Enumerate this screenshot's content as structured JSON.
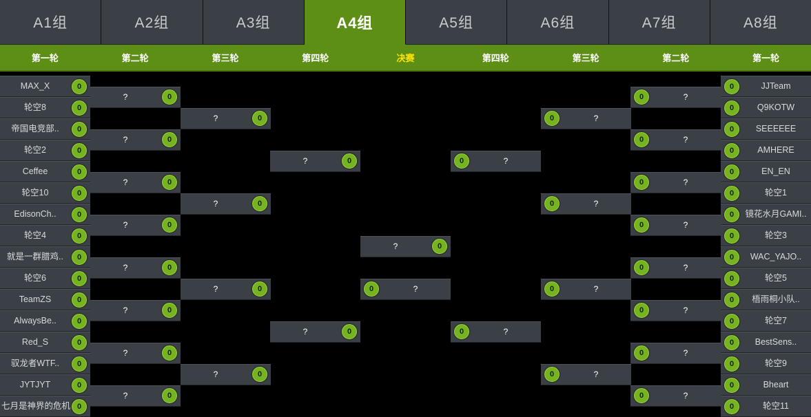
{
  "groups": {
    "active_index": 3,
    "tabs": [
      {
        "label": "A1组"
      },
      {
        "label": "A2组"
      },
      {
        "label": "A3组"
      },
      {
        "label": "A4组"
      },
      {
        "label": "A5组"
      },
      {
        "label": "A6组"
      },
      {
        "label": "A7组"
      },
      {
        "label": "A8组"
      }
    ]
  },
  "rounds": [
    {
      "label": "第一轮",
      "final": false
    },
    {
      "label": "第二轮",
      "final": false
    },
    {
      "label": "第三轮",
      "final": false
    },
    {
      "label": "第四轮",
      "final": false
    },
    {
      "label": "决赛",
      "final": true
    },
    {
      "label": "第四轮",
      "final": false
    },
    {
      "label": "第三轮",
      "final": false
    },
    {
      "label": "第二轮",
      "final": false
    },
    {
      "label": "第一轮",
      "final": false
    }
  ],
  "colors": {
    "brand_green": "#5d8f16",
    "score_badge": "#76b322",
    "final_label": "#ffe400",
    "cell_bg": "#3b4046",
    "canvas_bg": "#000000"
  },
  "placeholder_name": "?",
  "default_score": "0",
  "bracket": {
    "left": {
      "round1": [
        {
          "name": "MAX_X",
          "score": "0"
        },
        {
          "name": "轮空8",
          "score": "0"
        },
        {
          "name": "帝国电竞部..",
          "score": "0"
        },
        {
          "name": "轮空2",
          "score": "0"
        },
        {
          "name": "Ceffee",
          "score": "0"
        },
        {
          "name": "轮空10",
          "score": "0"
        },
        {
          "name": "EdisonCh..",
          "score": "0"
        },
        {
          "name": "轮空4",
          "score": "0"
        },
        {
          "name": "就是一群腊鸡..",
          "score": "0"
        },
        {
          "name": "轮空6",
          "score": "0"
        },
        {
          "name": "TeamZS",
          "score": "0"
        },
        {
          "name": "AlwaysBe..",
          "score": "0"
        },
        {
          "name": "Red_S",
          "score": "0"
        },
        {
          "name": "驭龙者WTF..",
          "score": "0"
        },
        {
          "name": "JYTJYT",
          "score": "0"
        },
        {
          "name": "七月是神界的危机",
          "score": "0"
        }
      ],
      "round2": [
        {
          "name": "?",
          "score": "0"
        },
        {
          "name": "?",
          "score": "0"
        },
        {
          "name": "?",
          "score": "0"
        },
        {
          "name": "?",
          "score": "0"
        },
        {
          "name": "?",
          "score": "0"
        },
        {
          "name": "?",
          "score": "0"
        },
        {
          "name": "?",
          "score": "0"
        },
        {
          "name": "?",
          "score": "0"
        }
      ],
      "round3": [
        {
          "name": "?",
          "score": "0"
        },
        {
          "name": "?",
          "score": "0"
        },
        {
          "name": "?",
          "score": "0"
        },
        {
          "name": "?",
          "score": "0"
        }
      ],
      "round4": [
        {
          "name": "?",
          "score": "0"
        },
        {
          "name": "?",
          "score": "0"
        }
      ],
      "final": [
        {
          "name": "?",
          "score": "0"
        }
      ]
    },
    "right": {
      "round1": [
        {
          "name": "JJTeam",
          "score": "0"
        },
        {
          "name": "Q9KOTW",
          "score": "0"
        },
        {
          "name": "SEEEEEE",
          "score": "0"
        },
        {
          "name": "AMHERE",
          "score": "0"
        },
        {
          "name": "EN_EN",
          "score": "0"
        },
        {
          "name": "轮空1",
          "score": "0"
        },
        {
          "name": "镜花水月GAMI..",
          "score": "0"
        },
        {
          "name": "轮空3",
          "score": "0"
        },
        {
          "name": "WAC_YAJO..",
          "score": "0"
        },
        {
          "name": "轮空5",
          "score": "0"
        },
        {
          "name": "梧雨桐小队..",
          "score": "0"
        },
        {
          "name": "轮空7",
          "score": "0"
        },
        {
          "name": "BestSens..",
          "score": "0"
        },
        {
          "name": "轮空9",
          "score": "0"
        },
        {
          "name": "Bheart",
          "score": "0"
        },
        {
          "name": "轮空11",
          "score": "0"
        }
      ],
      "round2": [
        {
          "name": "?",
          "score": "0"
        },
        {
          "name": "?",
          "score": "0"
        },
        {
          "name": "?",
          "score": "0"
        },
        {
          "name": "?",
          "score": "0"
        },
        {
          "name": "?",
          "score": "0"
        },
        {
          "name": "?",
          "score": "0"
        },
        {
          "name": "?",
          "score": "0"
        },
        {
          "name": "?",
          "score": "0"
        }
      ],
      "round3": [
        {
          "name": "?",
          "score": "0"
        },
        {
          "name": "?",
          "score": "0"
        },
        {
          "name": "?",
          "score": "0"
        },
        {
          "name": "?",
          "score": "0"
        }
      ],
      "round4": [
        {
          "name": "?",
          "score": "0"
        },
        {
          "name": "?",
          "score": "0"
        }
      ],
      "final": [
        {
          "name": "?",
          "score": "0"
        }
      ]
    }
  }
}
